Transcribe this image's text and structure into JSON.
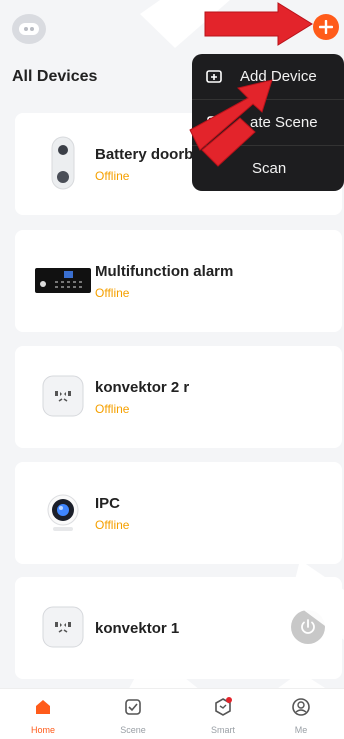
{
  "header": {
    "section_title": "All Devices",
    "home_icon": "home-switch-icon",
    "add_icon": "plus-circle-icon",
    "accent": "#ff5b1a"
  },
  "devices": [
    {
      "name": "Battery doorb",
      "status": "Offline",
      "icon": "doorbell-icon"
    },
    {
      "name": "Multifunction alarm",
      "status": "Offline",
      "icon": "alarm-panel-icon"
    },
    {
      "name": "konvektor 2 r",
      "status": "Offline",
      "icon": "smart-plug-icon"
    },
    {
      "name": "IPC",
      "status": "Offline",
      "icon": "camera-icon"
    },
    {
      "name": "konvektor 1",
      "status": "",
      "icon": "smart-plug-icon"
    }
  ],
  "status_color": "#f5a000",
  "menu": {
    "items": [
      {
        "label": "Add Device",
        "icon": "add-device-icon"
      },
      {
        "label": "ate Scene",
        "icon": "scene-icon"
      },
      {
        "label": "Scan",
        "icon": "scan-icon"
      }
    ]
  },
  "tabs": [
    {
      "label": "Home",
      "icon": "home-icon",
      "active": true
    },
    {
      "label": "Scene",
      "icon": "scene-check-icon",
      "active": false
    },
    {
      "label": "Smart",
      "icon": "smart-icon",
      "active": false
    },
    {
      "label": "Me",
      "icon": "profile-icon",
      "active": false
    }
  ],
  "annotation_color": "#e3242b"
}
